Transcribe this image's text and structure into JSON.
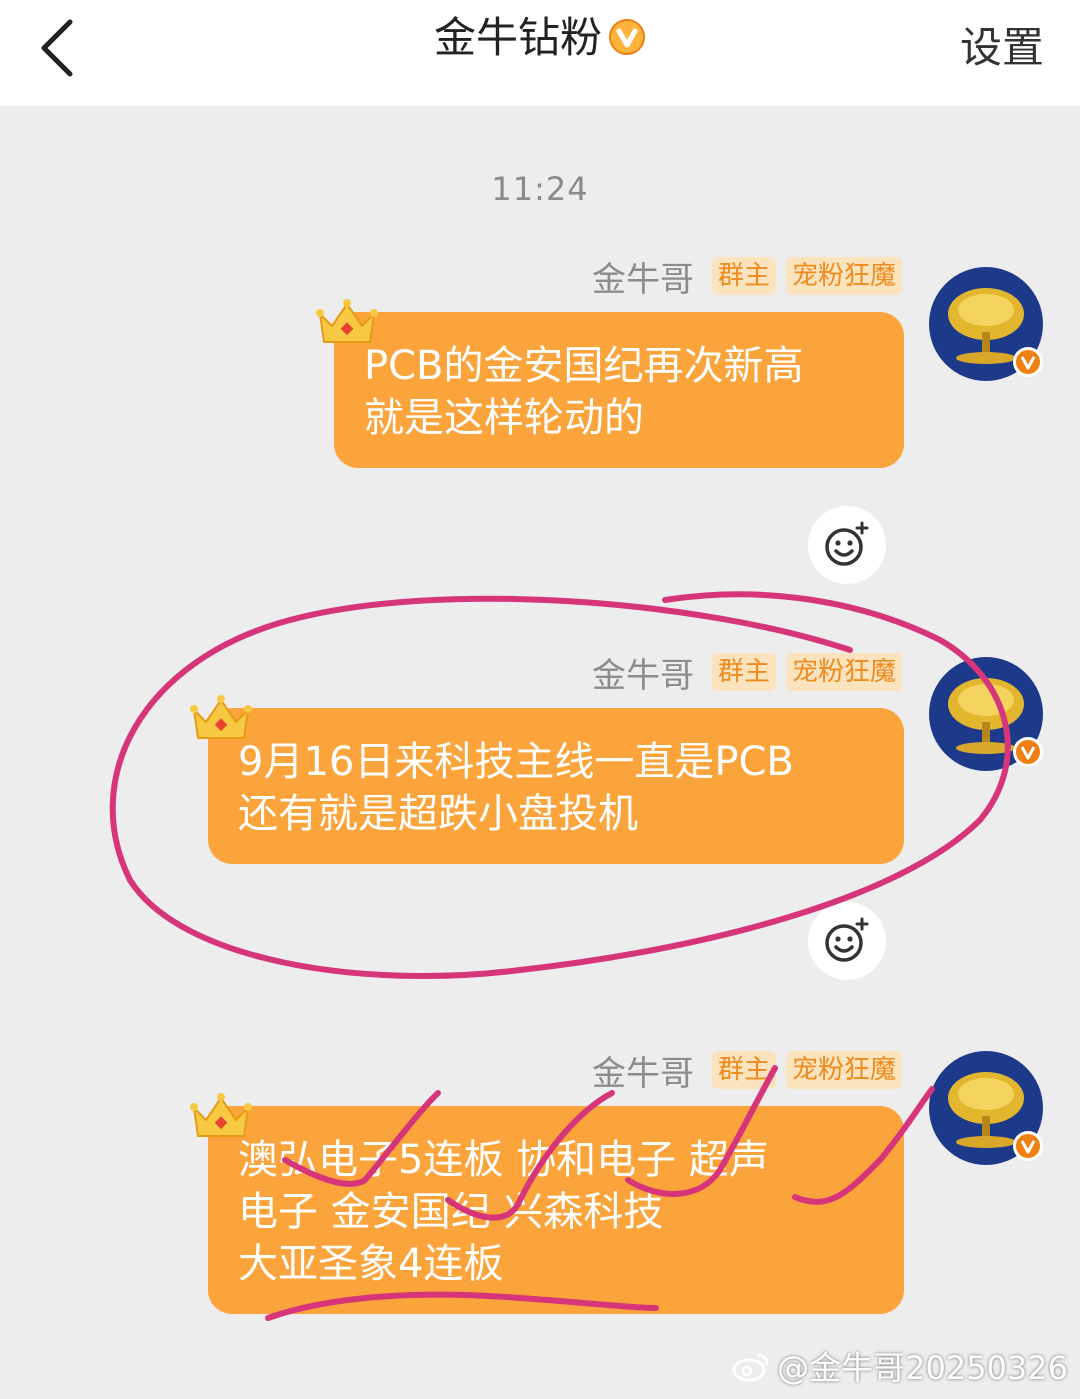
{
  "header": {
    "title": "金牛钻粉",
    "settings_label": "设置",
    "accent": "#fca43c"
  },
  "chat": {
    "timestamp": "11:24",
    "messages": [
      {
        "sender": "金牛哥",
        "badge_owner": "群主",
        "badge_title": "宠粉狂魔",
        "lines": [
          "PCB的金安国纪再次新高",
          "就是这样轮动的"
        ]
      },
      {
        "sender": "金牛哥",
        "badge_owner": "群主",
        "badge_title": "宠粉狂魔",
        "lines": [
          "9月16日来科技主线一直是PCB",
          "还有就是超跌小盘投机"
        ]
      },
      {
        "sender": "金牛哥",
        "badge_owner": "群主",
        "badge_title": "宠粉狂魔",
        "lines": [
          "澳弘电子5连板 协和电子 超声",
          "电子 金安国纪 兴森科技",
          "大亚圣象4连板"
        ]
      }
    ]
  },
  "watermark": "@金牛哥20250326",
  "colors": {
    "bubble": "#fca43c",
    "annotation": "#d6357a",
    "badge_text": "#f08a1c",
    "badge_bg": "#fbe3bd"
  }
}
